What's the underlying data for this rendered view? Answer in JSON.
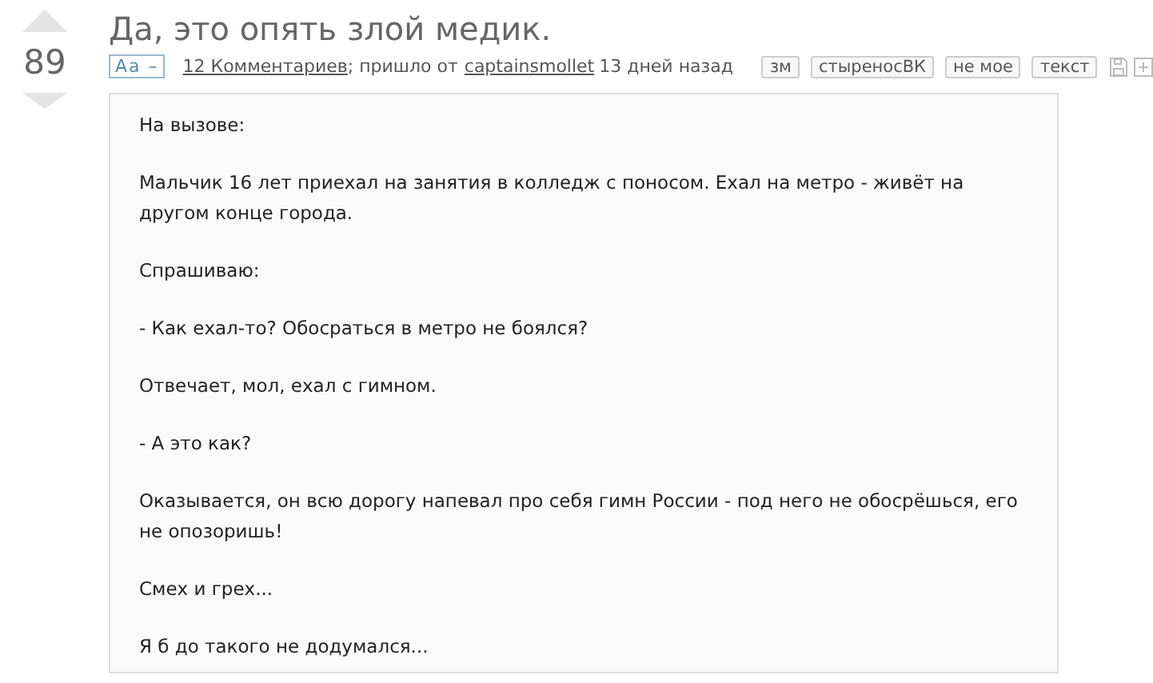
{
  "post": {
    "score": "89",
    "title": "Да, это опять злой медик.",
    "font_toggle": "Aa –",
    "comments_link": "12 Комментариев",
    "from_text": "; пришло от",
    "author": "captainsmollet",
    "time": "13 дней назад",
    "tags": [
      "зм",
      "стыреносВК",
      "не мое",
      "текст"
    ],
    "body": [
      "На вызове:",
      "Мальчик 16 лет приехал на занятия в колледж с поносом. Ехал на метро - живёт на другом конце города.",
      "Спрашиваю:",
      "- Как ехал-то? Обосраться в метро не боялся?",
      "Отвечает, мол, ехал с гимном.",
      "- А это как?",
      "Оказывается, он всю дорогу напевал про себя гимн России - под него не обосрёшься, его не опозоришь!",
      "Смех и грех...",
      "Я б до такого не додумался..."
    ]
  }
}
